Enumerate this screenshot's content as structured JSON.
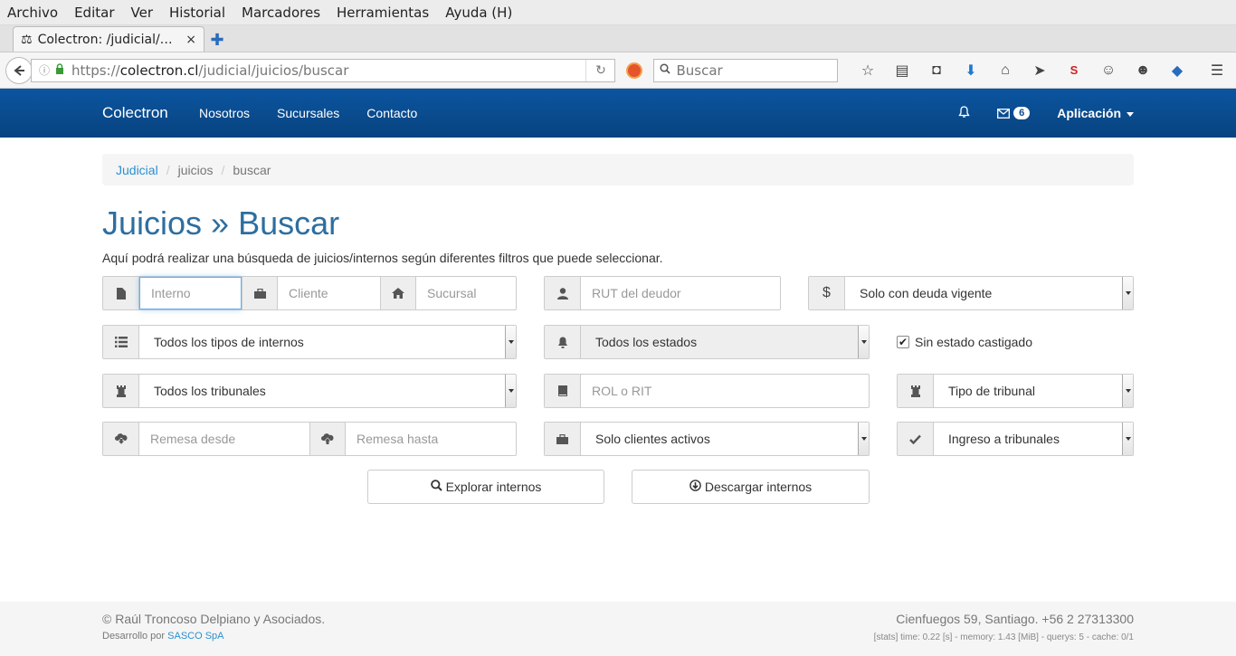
{
  "browser": {
    "menu": [
      "Archivo",
      "Editar",
      "Ver",
      "Historial",
      "Marcadores",
      "Herramientas",
      "Ayuda (H)"
    ],
    "tab_title": "Colectron: /judicial/…",
    "tab_close": "×",
    "new_tab": "✚",
    "url_prefix": "https://",
    "url_domain": "colectron.cl",
    "url_path": "/judicial/juicios/buscar",
    "search_placeholder": "Buscar"
  },
  "site": {
    "brand": "Colectron",
    "nav": [
      "Nosotros",
      "Sucursales",
      "Contacto"
    ],
    "messages_count": "6",
    "app_menu": "Aplicación"
  },
  "breadcrumb": {
    "items": [
      "Judicial",
      "juicios",
      "buscar"
    ],
    "sep": "/"
  },
  "page": {
    "title": "Juicios » Buscar",
    "intro": "Aquí podrá realizar una búsqueda de juicios/internos según diferentes filtros que puede seleccionar."
  },
  "form": {
    "interno_placeholder": "Interno",
    "cliente_placeholder": "Cliente",
    "sucursal_placeholder": "Sucursal",
    "rut_placeholder": "RUT del deudor",
    "deuda_select": "Solo con deuda vigente",
    "tipos_internos_select": "Todos los tipos de internos",
    "estados_select": "Todos los estados",
    "sin_castigado_label": "Sin estado castigado",
    "tribunales_select": "Todos los tribunales",
    "rol_placeholder": "ROL o RIT",
    "tipo_tribunal_select": "Tipo de tribunal",
    "remesa_desde_placeholder": "Remesa desde",
    "remesa_hasta_placeholder": "Remesa hasta",
    "clientes_select": "Solo clientes activos",
    "ingreso_select": "Ingreso a tribunales",
    "explorar_button": "Explorar internos",
    "descargar_button": "Descargar internos"
  },
  "footer": {
    "copyright": "© Raúl Troncoso Delpiano y Asociados.",
    "dev_prefix": "Desarrollo por",
    "dev_link": "SASCO SpA",
    "address": "Cienfuegos 59, Santiago. +56 2 27313300",
    "stats": "[stats] time: 0.22 [s] - memory: 1.43 [MiB] - querys: 5 - cache: 0/1"
  }
}
